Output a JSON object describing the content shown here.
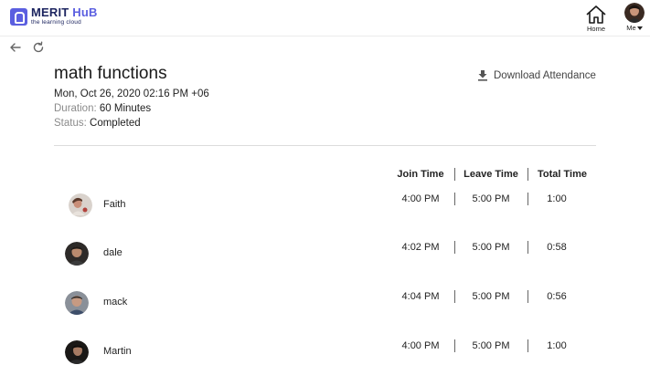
{
  "brand": {
    "name_part1": "MERIT",
    "name_part2": "HuB",
    "tagline": "the learning cloud",
    "primary_color": "#5b5fe0",
    "dark_color": "#1d2560"
  },
  "nav": {
    "home_label": "Home",
    "me_label": "Me"
  },
  "toolbar": {
    "back_icon": "arrow-left-icon",
    "refresh_icon": "refresh-icon"
  },
  "meeting": {
    "title": "math functions",
    "datetime": "Mon, Oct 26, 2020 02:16 PM +06",
    "duration_label": "Duration:",
    "duration_value": "60 Minutes",
    "status_label": "Status:",
    "status_value": "Completed"
  },
  "download": {
    "label": "Download Attendance",
    "icon": "download-icon"
  },
  "table": {
    "headers": {
      "join": "Join Time",
      "leave": "Leave Time",
      "total": "Total Time"
    },
    "rows": [
      {
        "name": "Faith",
        "join": "4:00 PM",
        "leave": "5:00 PM",
        "total": "1:00"
      },
      {
        "name": "dale",
        "join": "4:02 PM",
        "leave": "5:00 PM",
        "total": "0:58"
      },
      {
        "name": "mack",
        "join": "4:04 PM",
        "leave": "5:00 PM",
        "total": "0:56"
      },
      {
        "name": "Martin",
        "join": "4:00 PM",
        "leave": "5:00 PM",
        "total": "1:00"
      }
    ]
  }
}
